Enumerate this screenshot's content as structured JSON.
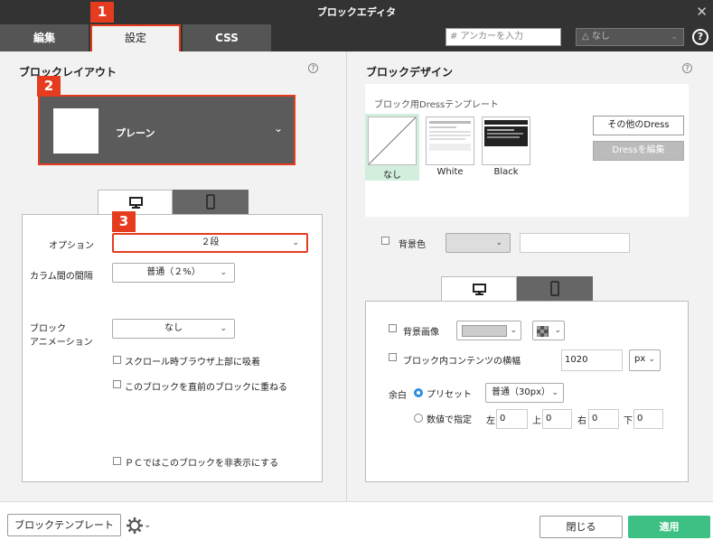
{
  "window": {
    "title": "ブロックエディタ"
  },
  "tabs": [
    {
      "label": "編集"
    },
    {
      "label": "設定"
    },
    {
      "label": "CSS"
    }
  ],
  "header": {
    "anchor_placeholder": "# アンカーを入力",
    "style_select_value": "なし"
  },
  "badges": [
    "1",
    "2",
    "3"
  ],
  "left": {
    "title": "ブロックレイアウト",
    "layout_value": "プレーン",
    "option_label": "オプション",
    "option_value": "２段",
    "gap_label": "カラム間の間隔",
    "gap_value": "普通（２%）",
    "anim_label_1": "ブロック",
    "anim_label_2": "アニメーション",
    "anim_value": "なし",
    "cb_scroll": "スクロール時ブラウザ上部に吸着",
    "cb_overlap": "このブロックを直前のブロックに重ねる",
    "cb_hide_pc": "ＰＣではこのブロックを非表示にする"
  },
  "right": {
    "title": "ブロックデザイン",
    "dress_title": "ブロック用Dressテンプレート",
    "dress_items": [
      {
        "label": "なし"
      },
      {
        "label": "White"
      },
      {
        "label": "Black"
      }
    ],
    "other_dress": "その他のDress",
    "edit_dress": "Dressを編集",
    "bg_color_label": "背景色",
    "bg_image_label": "背景画像",
    "content_width_label": "ブロック内コンテンツの横幅",
    "content_width_value": "1020",
    "unit_value": "px",
    "margin_label": "余白",
    "preset_label": "プリセット",
    "preset_value": "普通（30px）",
    "numeric_label": "数値で指定",
    "left_label": "左",
    "left_value": "0",
    "top_label": "上",
    "top_value": "0",
    "right_label": "右",
    "right_value": "0",
    "bottom_label": "下",
    "bottom_value": "0"
  },
  "footer": {
    "template_button": "ブロックテンプレート",
    "close_button": "閉じる",
    "apply_button": "適用"
  },
  "colors": {
    "accent_red": "#e53c1f",
    "apply_green": "#3cc084",
    "titlebar": "#333333"
  }
}
